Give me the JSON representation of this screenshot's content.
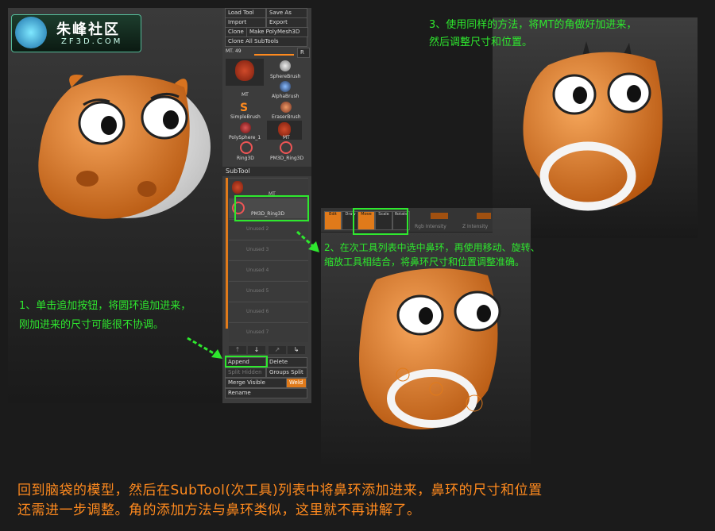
{
  "logo": {
    "title": "朱峰社区",
    "site": "ZF3D.COM"
  },
  "panel": {
    "top_buttons": [
      "Load Tool",
      "Save As",
      "Import",
      "Export",
      "Clone",
      "Make PolyMesh3D",
      "Clone All SubTools"
    ],
    "tool_name": "MT. 49",
    "r_button": "R",
    "tools": [
      "MT",
      "SphereBrush",
      "AlphaBrush",
      "SimpleBrush",
      "EraserBrush",
      "PolySphere_1",
      "MT",
      "Ring3D",
      "PM3D_Ring3D"
    ],
    "subtool_title": "SubTool",
    "subtool_items": [
      "MT",
      "PM3D_Ring3D",
      "Unused 2",
      "Unused 3",
      "Unused 4",
      "Unused 5",
      "Unused 6",
      "Unused 7"
    ],
    "bottom_buttons": [
      "Append",
      "Delete",
      "Split Hidden",
      "Groups Split",
      "Merge Visible",
      "Weld",
      "Rename"
    ]
  },
  "toolbar2": {
    "buttons": [
      "Edit",
      "Draw",
      "Move",
      "Scale",
      "Rotate"
    ],
    "extra": [
      "Rgb Intensity",
      "Z Intensity"
    ]
  },
  "annotations": {
    "a1": [
      "1、单击追加按钮，将圆环追加进来，",
      "刚加进来的尺寸可能很不协调。"
    ],
    "a2": [
      "2、在次工具列表中选中鼻环，再使用移动、旋转、",
      "缩放工具相结合，将鼻环尺寸和位置调整准确。"
    ],
    "a3": [
      "3、使用同样的方法，将MT的角做好加进来，",
      "然后调整尺寸和位置。"
    ]
  },
  "caption": [
    "回到脑袋的模型，然后在SubTool(次工具)列表中将鼻环添加进来，鼻环的尺寸和位置",
    "还需进一步调整。角的添加方法与鼻环类似，这里就不再讲解了。"
  ],
  "colors": {
    "accent": "#ff8a1e",
    "annotation": "#2ee82e",
    "skin": "#e8832a"
  }
}
